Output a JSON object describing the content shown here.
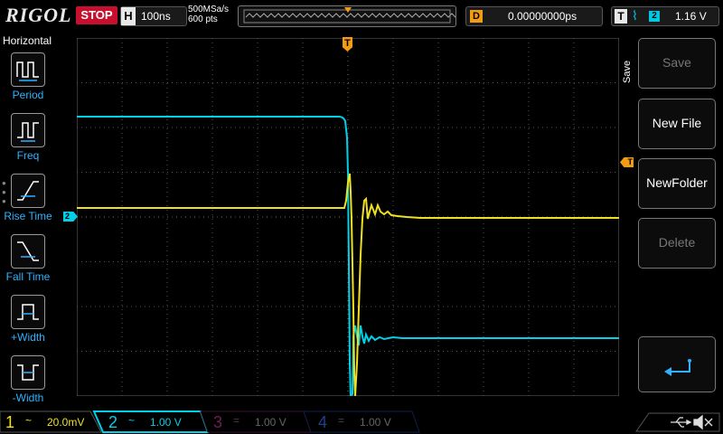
{
  "top": {
    "logo": "RIGOL",
    "run_state": "STOP",
    "h_key": "H",
    "timebase": "100ns",
    "sample_rate": "500MSa/s",
    "mem_depth": "600 pts",
    "d_key": "D",
    "delay": "0.00000000ps",
    "t_key": "T",
    "trigger_source": "2",
    "trigger_level": "1.16 V"
  },
  "left_menu": {
    "title": "Horizontal",
    "items": [
      {
        "label": "Period",
        "icon": "period-icon"
      },
      {
        "label": "Freq",
        "icon": "freq-icon"
      },
      {
        "label": "Rise Time",
        "icon": "rise-time-icon"
      },
      {
        "label": "Fall Time",
        "icon": "fall-time-icon"
      },
      {
        "label": "+Width",
        "icon": "positive-width-icon"
      },
      {
        "label": "-Width",
        "icon": "negative-width-icon"
      }
    ]
  },
  "right_menu": {
    "title": "Save",
    "buttons": [
      {
        "label": "Save",
        "enabled": false
      },
      {
        "label": "New File",
        "enabled": true
      },
      {
        "label": "NewFolder",
        "enabled": true
      },
      {
        "label": "Delete",
        "enabled": false
      }
    ],
    "enter_icon": "enter-return-icon"
  },
  "markers": {
    "trigger_pos": "T",
    "trigger_level": "T",
    "ch2_ground": "2"
  },
  "channels": [
    {
      "num": "1",
      "coupling": "~",
      "scale": "20.0mV",
      "color": "#f0e020",
      "active": true
    },
    {
      "num": "2",
      "coupling": "~",
      "scale": "1.00 V",
      "color": "#00d0e8",
      "active": true
    },
    {
      "num": "3",
      "coupling": "=",
      "scale": "1.00 V",
      "color": "#b0308a",
      "active": false
    },
    {
      "num": "4",
      "coupling": "=",
      "scale": "1.00 V",
      "color": "#2060d0",
      "active": false
    }
  ],
  "status_icons": [
    "usb-icon",
    "speaker-muted-icon"
  ],
  "colors": {
    "ch1": "#f0e020",
    "ch2": "#00d0e8",
    "accent_blue": "#2fb2ff",
    "trigger_orange": "#f39c12",
    "stop_red": "#c8102e"
  }
}
